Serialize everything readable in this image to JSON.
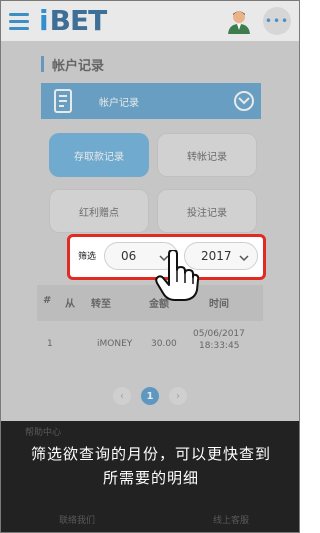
{
  "header": {
    "logo_i": "i",
    "logo_bet": "BET",
    "more_label": "•••"
  },
  "page": {
    "title": "帐户记录",
    "banner_label": "帐户记录"
  },
  "buttons": {
    "deposit_withdraw": "存取款记录",
    "transfer": "转帐记录",
    "rebate_bonus": "红利赠点",
    "bet_record": "投注记录"
  },
  "filter": {
    "label": "筛选",
    "month": "06",
    "year": "2017"
  },
  "table": {
    "headers": [
      "#",
      "从",
      "转至",
      "金额",
      "时间"
    ],
    "rows": [
      {
        "index": "1",
        "from": "",
        "to": "iMONEY",
        "amount": "30.00",
        "date": "05/06/2017",
        "time": "18:33:45"
      }
    ]
  },
  "pagination": {
    "prev": "‹",
    "current": "1",
    "next": "›"
  },
  "footer_ghost": {
    "left_link": "帮助中心",
    "contact": "联络我们",
    "service": "线上客服"
  },
  "caption": {
    "line1": "筛选欲查询的月份，可以更快查到",
    "line2": "所需要的明细"
  },
  "colors": {
    "brand_blue": "#2e86c1",
    "highlight_red": "#e02a22",
    "active_button": "#3d9ad6"
  }
}
